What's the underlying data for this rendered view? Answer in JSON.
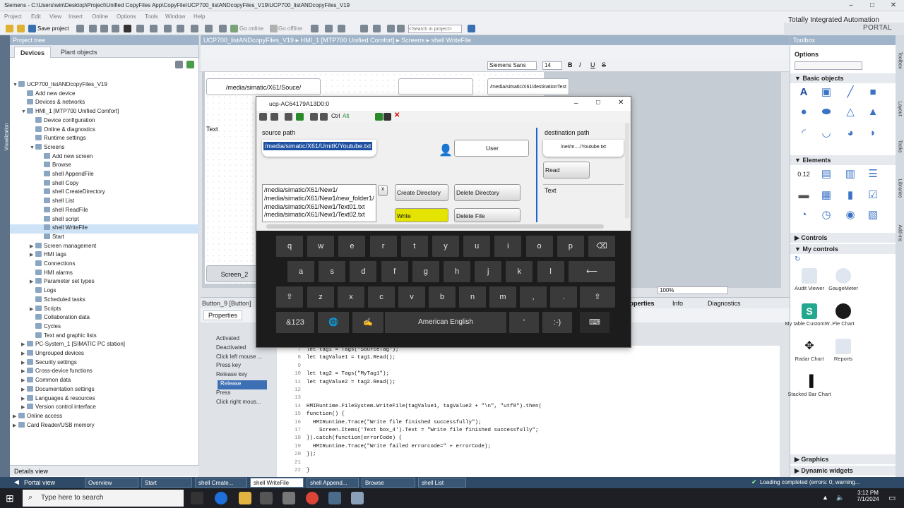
{
  "app": {
    "title": "Siemens  -  C:\\Users\\win\\Desktop\\Project\\Unified CopyFiles App\\CopyFile\\UCP700_listANDcopyFiles_V19\\UCP700_listANDcopyFiles_V19",
    "brand_line1": "Totally Integrated Automation",
    "brand_line2": "PORTAL"
  },
  "menu": [
    "Project",
    "Edit",
    "View",
    "Insert",
    "Online",
    "Options",
    "Tools",
    "Window",
    "Help"
  ],
  "toolbar": {
    "save": "Save project",
    "go_online": "Go online",
    "go_offline": "Go offline",
    "search_placeholder": "<Search in project>"
  },
  "project_tree": {
    "title": "Project tree",
    "tabs": [
      "Devices",
      "Plant objects"
    ],
    "vertical_tab": "Visualization",
    "items": [
      {
        "label": "UCP700_listANDcopyFiles_V19",
        "indent": 0,
        "tw": "▼"
      },
      {
        "label": "Add new device",
        "indent": 1,
        "tw": ""
      },
      {
        "label": "Devices & networks",
        "indent": 1,
        "tw": ""
      },
      {
        "label": "HMI_1 [MTP700 Unified Comfort]",
        "indent": 1,
        "tw": "▼"
      },
      {
        "label": "Device configuration",
        "indent": 2,
        "tw": ""
      },
      {
        "label": "Online & diagnostics",
        "indent": 2,
        "tw": ""
      },
      {
        "label": "Runtime settings",
        "indent": 2,
        "tw": ""
      },
      {
        "label": "Screens",
        "indent": 2,
        "tw": "▼"
      },
      {
        "label": "Add new screen",
        "indent": 3,
        "tw": ""
      },
      {
        "label": "Browse",
        "indent": 3,
        "tw": ""
      },
      {
        "label": "shell AppendFile",
        "indent": 3,
        "tw": ""
      },
      {
        "label": "shell Copy",
        "indent": 3,
        "tw": ""
      },
      {
        "label": "shell CreateDirectory",
        "indent": 3,
        "tw": ""
      },
      {
        "label": "shell List",
        "indent": 3,
        "tw": ""
      },
      {
        "label": "shell ReadFile",
        "indent": 3,
        "tw": ""
      },
      {
        "label": "shell script",
        "indent": 3,
        "tw": ""
      },
      {
        "label": "shell WriteFile",
        "indent": 3,
        "tw": "",
        "sel": true
      },
      {
        "label": "Start",
        "indent": 3,
        "tw": ""
      },
      {
        "label": "Screen management",
        "indent": 2,
        "tw": "▶"
      },
      {
        "label": "HMI tags",
        "indent": 2,
        "tw": "▶"
      },
      {
        "label": "Connections",
        "indent": 2,
        "tw": ""
      },
      {
        "label": "HMI alarms",
        "indent": 2,
        "tw": ""
      },
      {
        "label": "Parameter set types",
        "indent": 2,
        "tw": "▶"
      },
      {
        "label": "Logs",
        "indent": 2,
        "tw": ""
      },
      {
        "label": "Scheduled tasks",
        "indent": 2,
        "tw": ""
      },
      {
        "label": "Scripts",
        "indent": 2,
        "tw": "▶"
      },
      {
        "label": "Collaboration data",
        "indent": 2,
        "tw": ""
      },
      {
        "label": "Cycles",
        "indent": 2,
        "tw": ""
      },
      {
        "label": "Text and graphic lists",
        "indent": 2,
        "tw": ""
      },
      {
        "label": "PC-System_1 [SIMATIC PC station]",
        "indent": 1,
        "tw": "▶"
      },
      {
        "label": "Ungrouped devices",
        "indent": 1,
        "tw": "▶"
      },
      {
        "label": "Security settings",
        "indent": 1,
        "tw": "▶"
      },
      {
        "label": "Cross-device functions",
        "indent": 1,
        "tw": "▶"
      },
      {
        "label": "Common data",
        "indent": 1,
        "tw": "▶"
      },
      {
        "label": "Documentation settings",
        "indent": 1,
        "tw": "▶"
      },
      {
        "label": "Languages & resources",
        "indent": 1,
        "tw": "▶"
      },
      {
        "label": "Version control interface",
        "indent": 1,
        "tw": "▶"
      },
      {
        "label": "Online access",
        "indent": 0,
        "tw": "▶"
      },
      {
        "label": "Card Reader/USB memory",
        "indent": 0,
        "tw": "▶"
      }
    ],
    "details_view": "Details view"
  },
  "editor": {
    "breadcrumb": "UCP700_listANDcopyFiles_V19  ▸  HMI_1 [MTP700 Unified Comfort]  ▸  Screens  ▸  shell WriteFile",
    "font": "Siemens Sans",
    "font_size": "14",
    "zoom": "100%",
    "canvas": {
      "source_label": "Source path",
      "source_value": "/media/simatic/X61/Souce/",
      "dest_label": "destination path",
      "dest_value": "/media/simatic/X61/destinationTest",
      "text_label": "Text",
      "screen_btn": "Screen_2"
    }
  },
  "properties": {
    "title": "Button_9 [Button]",
    "tabs": [
      "Properties",
      "Events",
      "Texts"
    ],
    "right_tabs": [
      "Properties",
      "Info",
      "Diagnostics"
    ],
    "events": [
      "Activated",
      "Deactivated",
      "Click left mouse ...",
      "Press key",
      "Release key",
      "Press",
      "Release",
      "Click right mous..."
    ]
  },
  "code": [
    {
      "n": "7",
      "t": "let tag1 = Tags(\"SourceTag\");"
    },
    {
      "n": "8",
      "t": "let tagValue1 = tag1.Read();"
    },
    {
      "n": "9",
      "t": ""
    },
    {
      "n": "10",
      "t": "let tag2 = Tags(\"MyTag1\");"
    },
    {
      "n": "11",
      "t": "let tagValue2 = tag2.Read();"
    },
    {
      "n": "12",
      "t": ""
    },
    {
      "n": "13",
      "t": ""
    },
    {
      "n": "14",
      "t": "HMIRuntime.FileSystem.WriteFile(tagValue1, tagValue2 + \"\\n\", \"utf8\").then("
    },
    {
      "n": "15",
      "t": "function() {"
    },
    {
      "n": "16",
      "t": "  HMIRuntime.Trace(\"Write file finished successfully\");"
    },
    {
      "n": "17",
      "t": "    Screen.Items('Text box_4').Text = \"Write file finished successfully\";"
    },
    {
      "n": "18",
      "t": "}).catch(function(errorCode) {"
    },
    {
      "n": "19",
      "t": "  HMIRuntime.Trace(\"Write failed errorcode=\" + errorCode);"
    },
    {
      "n": "20",
      "t": "});"
    },
    {
      "n": "21",
      "t": ""
    },
    {
      "n": "22",
      "t": "}"
    }
  ],
  "toolbox": {
    "title": "Toolbox",
    "options": "Options",
    "basic_objects": "Basic objects",
    "elements": "Elements",
    "controls": "Controls",
    "my_controls": "My controls",
    "graphics": "Graphics",
    "dynamic_widgets": "Dynamic widgets",
    "my_controls_items": [
      "Audit Viewer",
      "GaugeMeter",
      "My table CustomW...",
      "Pie Chart",
      "Radar Chart",
      "Reports",
      "Stacked Bar Chart"
    ],
    "side_tabs": [
      "Toolbox",
      "Layout",
      "Tasks",
      "Libraries",
      "Add-ins"
    ]
  },
  "runtime": {
    "title": "ucp-AC64179A13D0:0",
    "source_label": "source path",
    "source_value": "/media/simatic/X61/UmitK/Youtube.txt",
    "user_btn": "User",
    "dest_label": "destination path",
    "dest_value": "/net/m..../Youtube.txt",
    "read_btn": "Read",
    "text_label": "Text",
    "list": [
      "/media/simatic/X61/New1/",
      "/media/simatic/X61/New1/new_folder1/",
      "/media/simatic/X61/New1/Text01.txt",
      "/media/simatic/X61/New1/Text02.txt"
    ],
    "list_close": "x",
    "create_dir": "Create Directory",
    "delete_dir": "Delete Directory",
    "write_btn": "Write",
    "delete_file": "Delete File",
    "write_color": "#e4e400",
    "keyboard": {
      "row1": [
        "q",
        "w",
        "e",
        "r",
        "t",
        "y",
        "u",
        "i",
        "o",
        "p"
      ],
      "row2": [
        "a",
        "s",
        "d",
        "f",
        "g",
        "h",
        "j",
        "k",
        "l"
      ],
      "row3": [
        "z",
        "x",
        "c",
        "v",
        "b",
        "n",
        "m",
        ",",
        "."
      ],
      "sym": "&123",
      "space": "American English",
      "apos": "'",
      "smile": ":-)"
    }
  },
  "portal": {
    "portal_view": "Portal view",
    "tabs": [
      "Overview",
      "Start",
      "shell Create...",
      "shell WriteFile",
      "shell Append...",
      "Browse",
      "shell List"
    ],
    "status": "Loading completed (errors: 0; warning..."
  },
  "taskbar": {
    "search": "Type here to search",
    "time": "3:12 PM",
    "date": "7/1/2024"
  }
}
